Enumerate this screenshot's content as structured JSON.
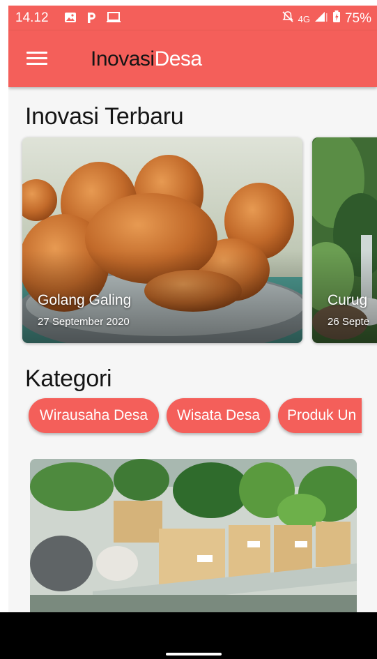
{
  "status_bar": {
    "time": "14.12",
    "network": "4G",
    "battery": "75%",
    "icons": [
      "image-icon",
      "parking-icon",
      "laptop-icon",
      "mute-icon",
      "signal-icon",
      "battery-icon"
    ]
  },
  "app_bar": {
    "brand_part1": "Inovasi",
    "brand_part2": "Desa",
    "menu_icon": "hamburger-menu-icon"
  },
  "latest": {
    "title": "Inovasi Terbaru",
    "cards": [
      {
        "title": "Golang Galing",
        "date": "27 September 2020"
      },
      {
        "title": "Curug",
        "date": "26 Septe"
      }
    ]
  },
  "categories": {
    "title": "Kategori",
    "chips": [
      "Wirausaha Desa",
      "Wisata Desa",
      "Produk Un"
    ]
  },
  "colors": {
    "accent": "#f45f5a",
    "text_dark": "#151515",
    "background": "#f6f6f6"
  }
}
